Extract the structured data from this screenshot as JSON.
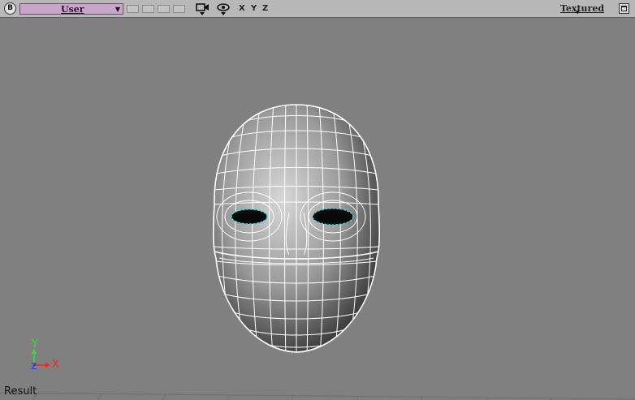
{
  "toolbar": {
    "badge": "B",
    "camera": {
      "selected": "User",
      "arrow_icon": "triangle-down-icon"
    },
    "icons": [
      "camera-icon",
      "eye-icon"
    ],
    "axes": [
      "X",
      "Y",
      "Z"
    ],
    "display_mode": "Textured",
    "maximize_icon": "maximize-icon"
  },
  "viewport": {
    "axis_gizmo": {
      "x": "X",
      "y": "Y",
      "z": "Z"
    },
    "status": "Result",
    "colors": {
      "background": "#808080",
      "wireframe": "#ffffff",
      "selection": "#33d6e0",
      "axis_x": "#ff2020",
      "axis_y": "#30e030",
      "axis_z": "#3030ff"
    }
  }
}
